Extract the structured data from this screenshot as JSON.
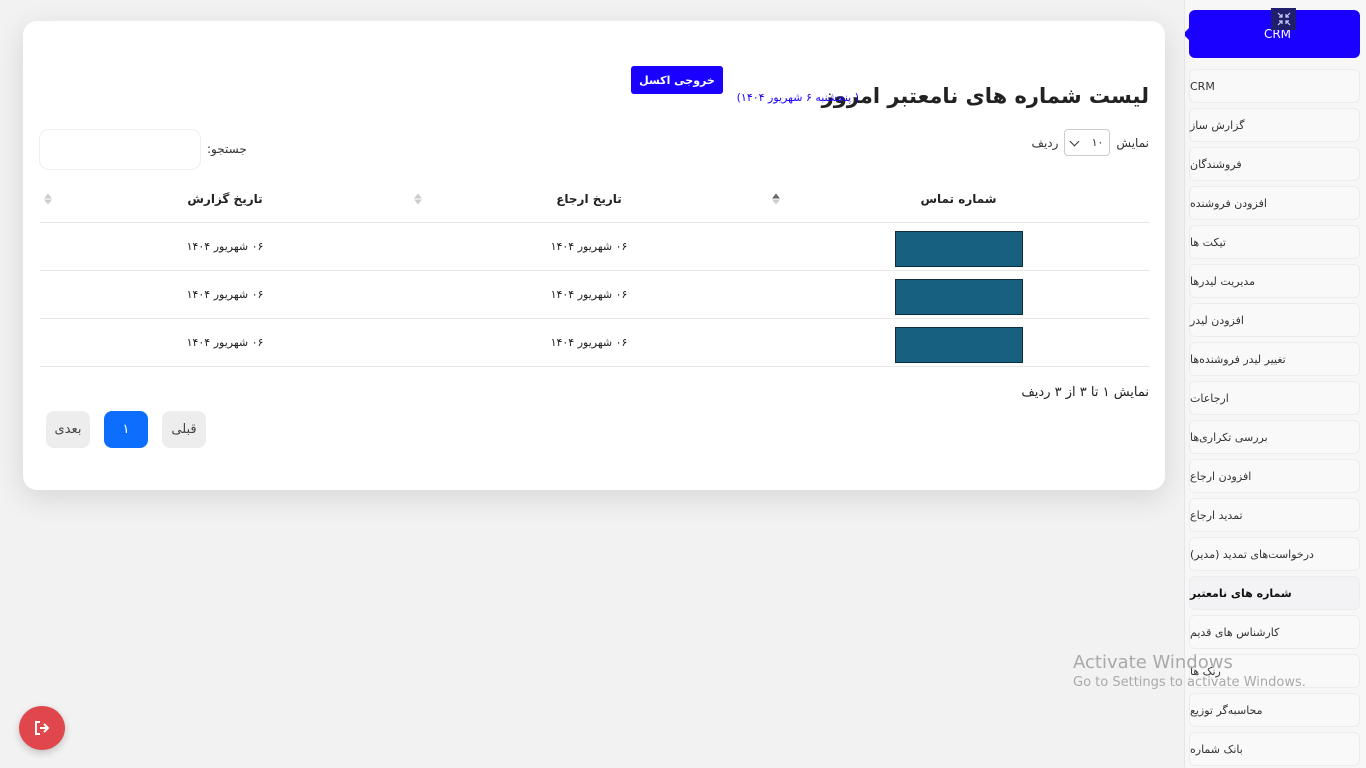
{
  "sidebar": {
    "brand": "CRM",
    "items": [
      {
        "label": "CRM",
        "active": false
      },
      {
        "label": "گزارش ساز",
        "active": false
      },
      {
        "label": "فروشندگان",
        "active": false
      },
      {
        "label": "افزودن فروشنده",
        "active": false
      },
      {
        "label": "تیکت ها",
        "active": false
      },
      {
        "label": "مدیریت لیدرها",
        "active": false
      },
      {
        "label": "افزودن لیدر",
        "active": false
      },
      {
        "label": "تغییر لیدر فروشنده‌ها",
        "active": false
      },
      {
        "label": "ارجاعات",
        "active": false
      },
      {
        "label": "بررسی تکراری‌ها",
        "active": false
      },
      {
        "label": "افزودن ارجاع",
        "active": false
      },
      {
        "label": "تمدید ارجاع",
        "active": false
      },
      {
        "label": "درخواست‌های تمدید (مدیر)",
        "active": false
      },
      {
        "label": "شماره های نامعتبر",
        "active": true
      },
      {
        "label": "کارشناس های قدیم",
        "active": false
      },
      {
        "label": "رنک ها",
        "active": false
      },
      {
        "label": "محاسبه‌گر توزیع",
        "active": false
      },
      {
        "label": "بانک شماره",
        "active": false
      }
    ]
  },
  "header": {
    "title": "لیست شماره های نامعتبر امروز",
    "date": "( پنجشنبه ۶ شهریور ۱۴۰۴)",
    "export_label": "خروجی اکسل"
  },
  "controls": {
    "show_label": "نمایش",
    "rows_label": "ردیف",
    "page_length": "۱۰",
    "search_label": "جستجو:"
  },
  "table": {
    "columns": [
      "شماره تماس",
      "تاریخ ارجاع",
      "تاریخ گزارش"
    ],
    "rows": [
      {
        "referral_date": "۰۶ شهریور ۱۴۰۴",
        "report_date": "۰۶ شهریور ۱۴۰۴"
      },
      {
        "referral_date": "۰۶ شهریور ۱۴۰۴",
        "report_date": "۰۶ شهریور ۱۴۰۴"
      },
      {
        "referral_date": "۰۶ شهریور ۱۴۰۴",
        "report_date": "۰۶ شهریور ۱۴۰۴"
      }
    ]
  },
  "footer": {
    "info": "نمایش ۱ تا ۳ از ۳ ردیف",
    "prev_label": "قبلی",
    "current_page": "۱",
    "next_label": "بعدی"
  },
  "watermark": {
    "title": "Activate Windows",
    "subtitle": "Go to Settings to activate Windows."
  },
  "colors": {
    "accent": "#1a00ff",
    "pager_active": "#0d6efd",
    "logout": "#e0474c",
    "redacted": "#17607f"
  },
  "icons": {
    "collapse": "collapse-arrows-icon",
    "logout": "logout-icon",
    "select": "chevron-down-icon",
    "sort": "sort-icon"
  }
}
